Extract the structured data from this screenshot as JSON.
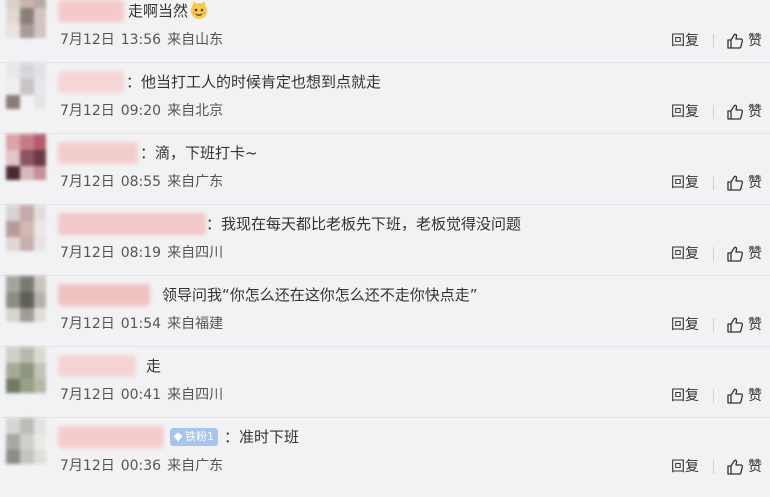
{
  "comments": [
    {
      "text": "走啊当然",
      "date": "7月12日",
      "time": "13:56",
      "location": "来自山东",
      "reply_label": "回复",
      "like_label": "赞",
      "has_emoji": true,
      "avatar_colors": [
        "#d9cfc9",
        "#c9b5ab",
        "#b7a8a2",
        "#e0d8d2",
        "#8c7f7a",
        "#d2c5be",
        "#e9e3df",
        "#a69a95",
        "#cfc4bf"
      ],
      "nickname_color": "#f4c9c9"
    },
    {
      "text": "：他当打工人的时候肯定也想到点就走",
      "date": "7月12日",
      "time": "09:20",
      "location": "来自北京",
      "reply_label": "回复",
      "like_label": "赞",
      "avatar_colors": [
        "#eae7ea",
        "#d8d6dc",
        "#e3e0e6",
        "#f0eef1",
        "#c9c3c6",
        "#e8e6ea",
        "#8b7b73",
        "#f2f2f4",
        "#e6e3e6"
      ],
      "nickname_color": "#f5d6d6"
    },
    {
      "text": "：滴，下班打卡~",
      "date": "7月12日",
      "time": "08:55",
      "location": "来自广东",
      "reply_label": "回复",
      "like_label": "赞",
      "avatar_colors": [
        "#d8a5a8",
        "#c47d86",
        "#b85a6c",
        "#e3c5c8",
        "#8a5561",
        "#6b3a44",
        "#4b2b32",
        "#d7b9bb",
        "#c98d95"
      ],
      "nickname_color": "#f3cdcd"
    },
    {
      "text": "：我现在每天都比老板先下班，老板觉得没问题",
      "date": "7月12日",
      "time": "08:19",
      "location": "来自四川",
      "reply_label": "回复",
      "like_label": "赞",
      "avatar_colors": [
        "#d9d2d2",
        "#c4aaa8",
        "#e3dcdb",
        "#b79c9a",
        "#d3b7b3",
        "#ece6e5",
        "#e1d6d4",
        "#c7b0ad",
        "#e9e2e1"
      ],
      "nickname_color": "#f2c7c7"
    },
    {
      "text": "领导问我“你怎么还在这你怎么还不走你快点走”",
      "date": "7月12日",
      "time": "01:54",
      "location": "来自福建",
      "reply_label": "回复",
      "like_label": "赞",
      "avatar_colors": [
        "#a7a49d",
        "#7b7a72",
        "#c9c5bd",
        "#8d8c83",
        "#5f605a",
        "#b5b2aa",
        "#d7d4cd",
        "#9f9d95",
        "#e1ded8"
      ],
      "nickname_color": "#f0c1c1"
    },
    {
      "text": "走",
      "date": "7月12日",
      "time": "00:41",
      "location": "来自四川",
      "reply_label": "回复",
      "like_label": "赞",
      "avatar_colors": [
        "#cfd0c8",
        "#b8b9ae",
        "#d9dad3",
        "#a5a996",
        "#8d9480",
        "#c1c4b8",
        "#6f7a5f",
        "#97a084",
        "#b3b9a6"
      ],
      "nickname_color": "#f5d3d3"
    },
    {
      "text": "：准时下班",
      "date": "7月12日",
      "time": "00:36",
      "location": "来自广东",
      "reply_label": "回复",
      "like_label": "赞",
      "badge": "铁粉1",
      "avatar_colors": [
        "#d5d5d2",
        "#bcbcb8",
        "#e3e3e0",
        "#a7a7a3",
        "#cfcfcb",
        "#e9e9e6",
        "#8c8c88",
        "#c4c4c0",
        "#dededa"
      ],
      "nickname_color": "#f4cccc"
    }
  ],
  "colors": {
    "background": "#f2f2f5",
    "badge": "#a7c6ee"
  },
  "icons": {
    "like": "thumbs-up-icon",
    "emoji": "cat-face-emoji-icon",
    "badge": "diamond-icon"
  }
}
